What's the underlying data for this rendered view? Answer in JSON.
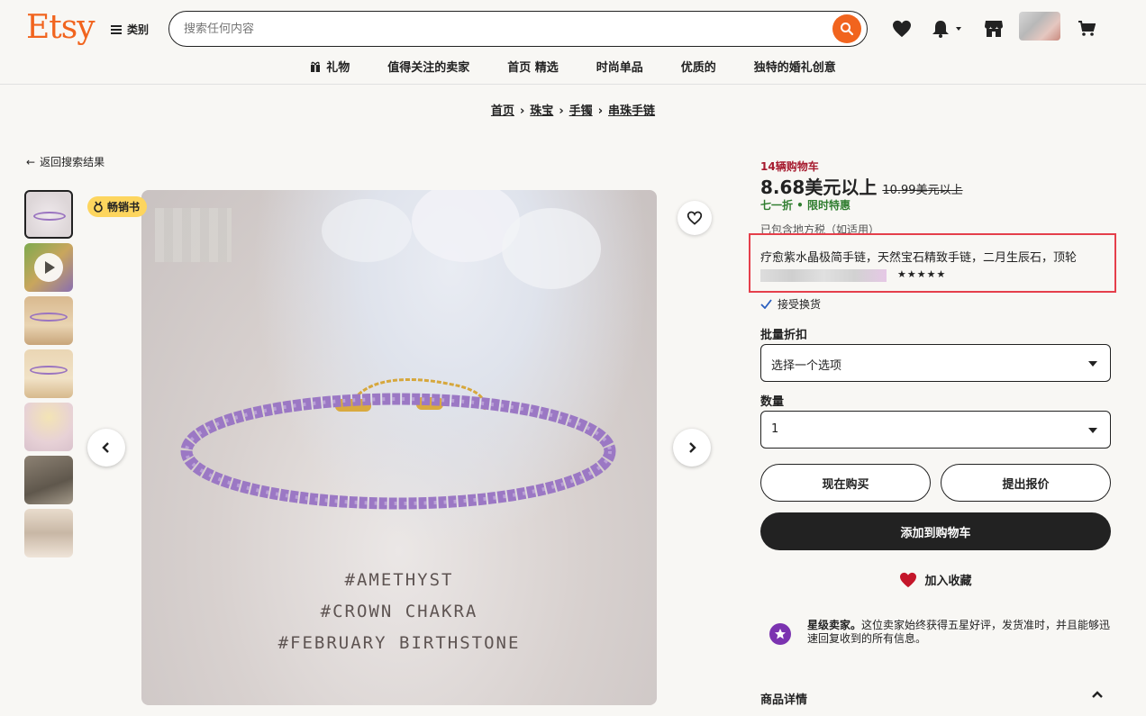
{
  "header": {
    "logo": "Etsy",
    "categories_label": "类别",
    "search_placeholder": "搜索任何内容"
  },
  "nav": [
    {
      "label": "礼物"
    },
    {
      "label": "值得关注的卖家"
    },
    {
      "label": "首页 精选"
    },
    {
      "label": "时尚单品"
    },
    {
      "label": "优质的"
    },
    {
      "label": "独特的婚礼创意"
    }
  ],
  "breadcrumb": [
    "首页",
    "珠宝",
    "手镯",
    "串珠手链"
  ],
  "back_label": "返回搜索结果",
  "bestseller_label": "畅销书",
  "image_captions": [
    "#AMETHYST",
    "#CROWN CHAKRA",
    "#FEBRUARY BIRTHSTONE"
  ],
  "product": {
    "cart_count": "14辆购物车",
    "price": "8.68美元以上",
    "old_price": "10.99美元以上",
    "sale": "七一折 • 限时特惠",
    "tax": "已包含地方税（如适用）",
    "title": "疗愈紫水晶极简手链，天然宝石精致手链，二月生辰石，顶轮",
    "stars": "★★★★★",
    "returns": "接受换货",
    "bulk_label": "批量折扣",
    "bulk_value": "选择一个选项",
    "qty_label": "数量",
    "qty_value": "1",
    "buy_now": "现在购买",
    "make_offer": "提出报价",
    "add_to_cart": "添加到购物车",
    "add_favorite": "加入收藏",
    "star_seller_title": "星级卖家。",
    "star_seller_text": "这位卖家始终获得五星好评，发货准时，并且能够迅速回复收到的所有信息。",
    "details_label": "商品详情"
  },
  "colors": {
    "brand": "#f1641e",
    "sale_green": "#2f7d2f",
    "cart_red": "#a61a2e",
    "highlight_border": "#e53f4b",
    "star_seller": "#7b33b0"
  }
}
